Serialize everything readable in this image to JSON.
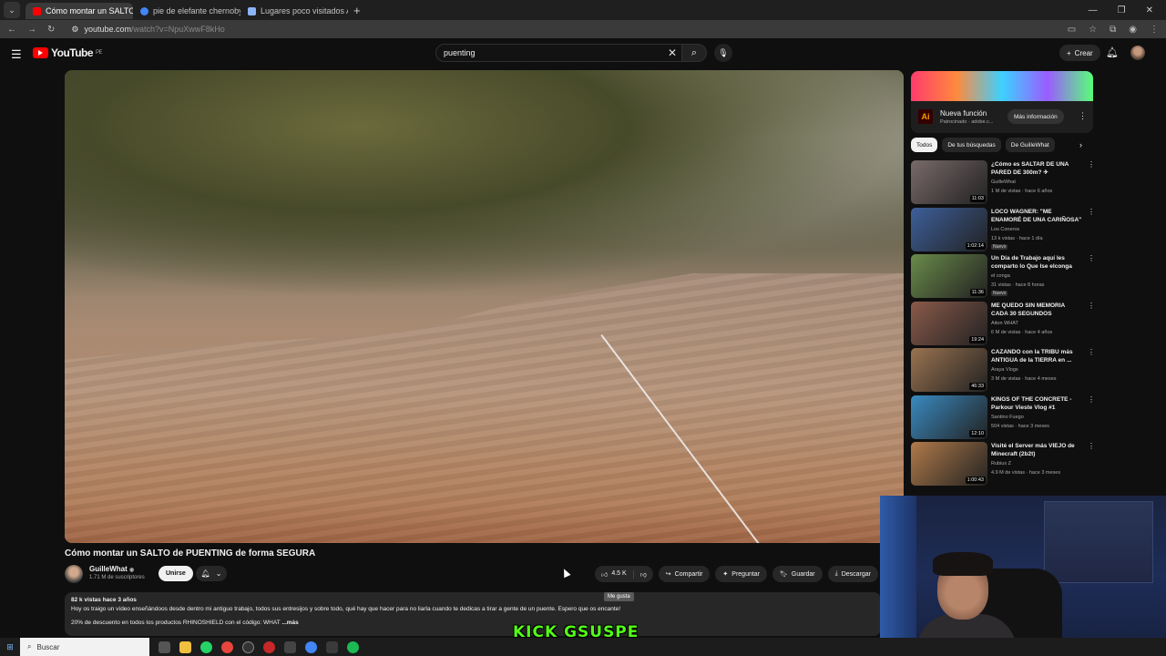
{
  "browser": {
    "tabs": [
      {
        "title": "Cómo montar un SALTO de",
        "active": true
      },
      {
        "title": "pie de elefante chernobyl - Bus",
        "active": false
      },
      {
        "title": "Lugares poco visitados Arequip",
        "active": false
      }
    ],
    "url_host": "youtube.com",
    "url_path": "/watch?v=NpuXwwF8kHo"
  },
  "header": {
    "logo_text": "YouTube",
    "logo_region": "PE",
    "search_value": "puenting",
    "create_label": "Crear"
  },
  "video": {
    "title": "Cómo montar un SALTO de PUENTING de forma SEGURA",
    "channel_name": "GuilleWhat",
    "subscribers": "1.71 M de suscriptores",
    "join_label": "Unirse",
    "likes": "4.5 K",
    "share_label": "Compartir",
    "ask_label": "Preguntar",
    "save_label": "Guardar",
    "download_label": "Descargar",
    "like_tooltip": "Me gusta",
    "description_meta": "82 k vistas  hace 3 años",
    "description_line1": "Hoy os traigo un vídeo enseñándoos desde dentro mi antiguo trabajo, todos sus entresijos y sobre todo, qué hay que hacer para no liarla cuando te dedicas a tirar a gente de un puente. Espero que os encante!",
    "description_line2": "20% de descuento en todos los productos RHINOSHIELD con el código: WHAT",
    "description_more": "...más"
  },
  "ad": {
    "logo": "Ai",
    "title": "Nueva función",
    "subtitle": "Patrocinado · adobe.c...",
    "button": "Más información"
  },
  "chips": [
    "Todos",
    "De tus búsquedas",
    "De GuilleWhat"
  ],
  "recommendations": [
    {
      "title": "¿Cómo es SALTAR DE UNA PARED DE 300m? ✈",
      "channel": "GuilleWhat",
      "meta": "1 M de vistas · hace 6 años",
      "duration": "11:03",
      "badge": "",
      "color": "#7a6a6a"
    },
    {
      "title": "LOCO WAGNER: \"ME ENAMORÉ DE UNA CARIÑOSA\" ¿ESTUVO ...",
      "channel": "Los Coneros",
      "meta": "13 k vistas · hace 1 día",
      "duration": "1:02:14",
      "badge": "Nuevo",
      "color": "#3d5f9a"
    },
    {
      "title": "Un Día de Trabajo aquí les comparto lo Que Ise elconga",
      "channel": "el conga",
      "meta": "31 vistas · hace 8 horas",
      "duration": "11:36",
      "badge": "Nuevo",
      "color": "#6a8b4a"
    },
    {
      "title": "ME QUEDO SIN MEMORIA CADA 30 SEGUNDOS",
      "channel": "Aiton WHAT",
      "meta": "6 M de vistas · hace 4 años",
      "duration": "19:24",
      "badge": "",
      "color": "#8a5a4a"
    },
    {
      "title": "CAZANDO con la TRIBU más ANTIGUA de la TIERRA en ...",
      "channel": "Araya Vlogs",
      "meta": "3 M de vistas · hace 4 meses",
      "duration": "46:33",
      "badge": "",
      "color": "#9a7350"
    },
    {
      "title": "KINGS OF THE CONCRETE - Parkour Vieste Vlog #1",
      "channel": "Santino Fuego",
      "meta": "504 vistas · hace 3 meses",
      "duration": "12:10",
      "badge": "",
      "color": "#3a8ac0"
    },
    {
      "title": "Visité el Server más VIEJO de Minecraft (2b2t)",
      "channel": "Rubius Z",
      "meta": "4.9 M de vistas · hace 3 meses",
      "duration": "1:00:43",
      "badge": "",
      "color": "#b07a4a"
    }
  ],
  "taskbar": {
    "search_placeholder": "Buscar"
  },
  "overlay_text": "KICK GSUSPE"
}
